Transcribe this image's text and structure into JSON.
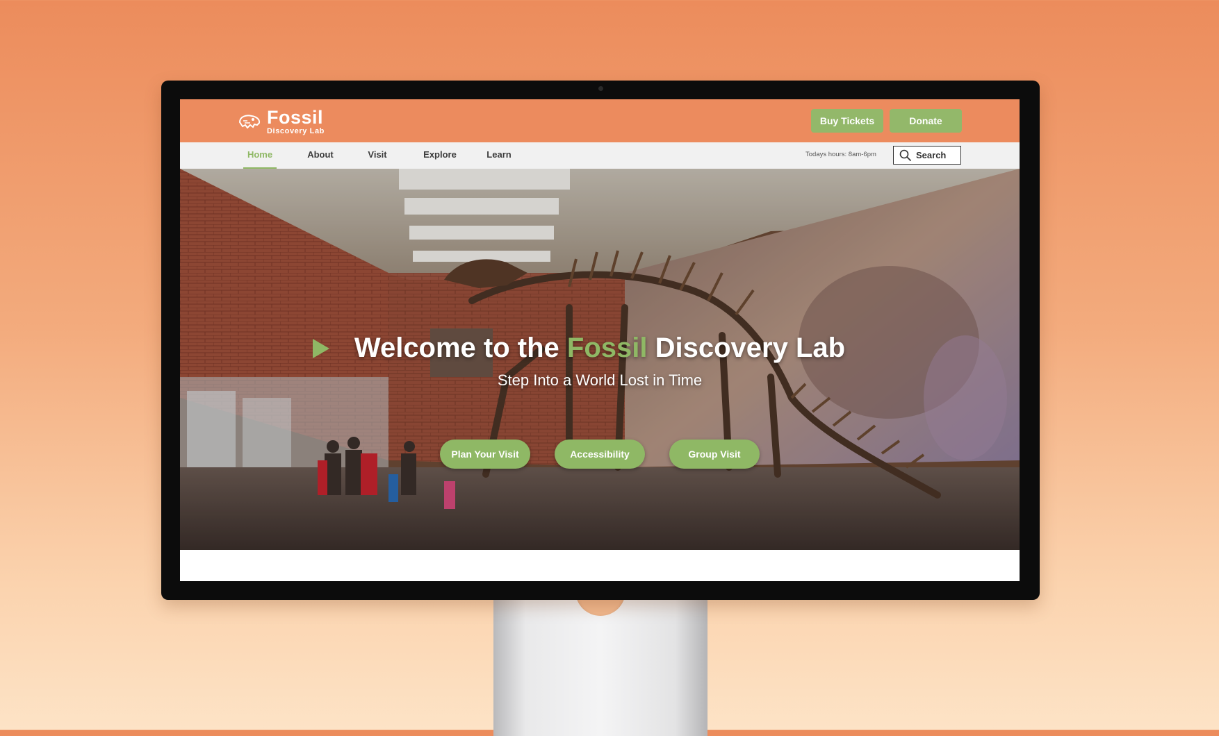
{
  "brand": {
    "name": "Fossil",
    "tagline": "Discovery Lab",
    "logo_icon": "dinosaur-skull-icon"
  },
  "header": {
    "buy_tickets": "Buy Tickets",
    "donate": "Donate"
  },
  "nav": {
    "items": [
      {
        "label": "Home",
        "active": true
      },
      {
        "label": "About",
        "active": false
      },
      {
        "label": "Visit",
        "active": false
      },
      {
        "label": "Explore",
        "active": false
      },
      {
        "label": "Learn",
        "active": false
      }
    ],
    "hours": "Todays hours: 8am-6pm",
    "search_label": "Search"
  },
  "hero": {
    "title_pre": "Welcome to the ",
    "title_accent": "Fossil",
    "title_post": " Discovery Lab",
    "subtitle": "Step Into a World Lost in Time",
    "buttons": {
      "plan": "Plan Your Visit",
      "accessibility": "Accessibility",
      "group": "Group Visit"
    }
  },
  "colors": {
    "brand_orange": "#ec8b5e",
    "accent_green": "#8fb865",
    "nav_bg": "#f1f1f1"
  }
}
